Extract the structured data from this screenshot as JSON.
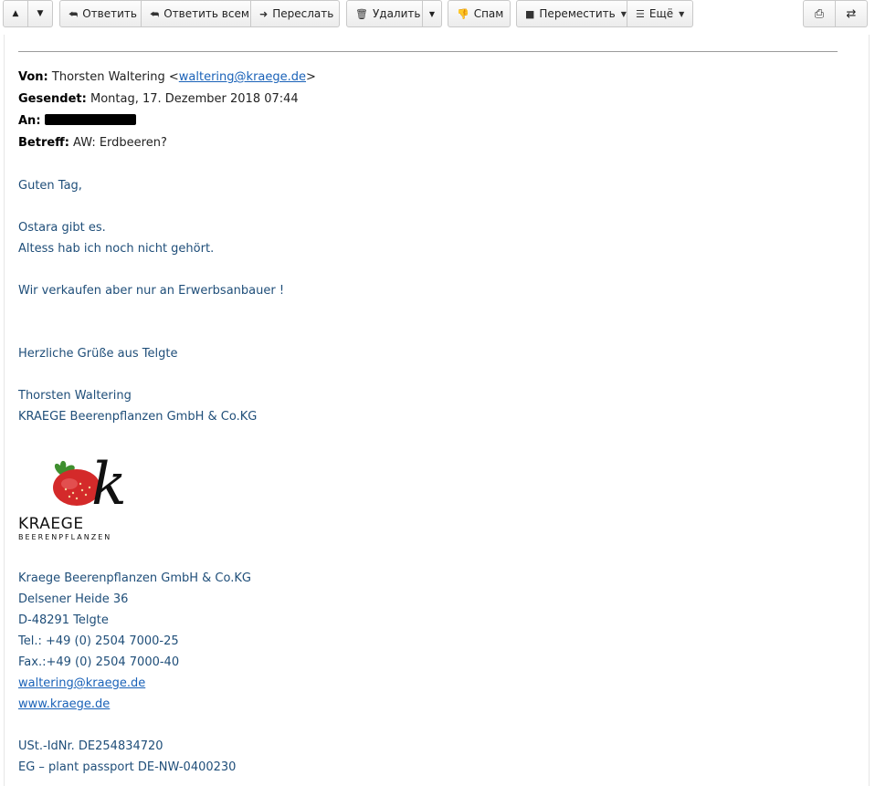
{
  "toolbar": {
    "prev_icon": "triangle-up-icon",
    "next_icon": "triangle-down-icon",
    "reply_label": "Ответить",
    "reply_all_label": "Ответить всем",
    "forward_label": "Переслать",
    "delete_label": "Удалить",
    "spam_label": "Спам",
    "move_label": "Переместить",
    "more_label": "Ещё"
  },
  "message": {
    "from_label": "Von:",
    "from_name": "Thorsten Waltering <",
    "from_email": "waltering@kraege.de",
    "from_close": ">",
    "sent_label": "Gesendet:",
    "sent_value": "Montag, 17. Dezember 2018 07:44",
    "to_label": "An:",
    "subject_label": "Betreff:",
    "subject_value": "AW: Erdbeeren?",
    "body": {
      "greeting": "Guten Tag,",
      "line1": "Ostara gibt es.",
      "line2": "Altess hab ich noch nicht gehört.",
      "line3": "Wir verkaufen aber nur an Erwerbsanbauer !",
      "closing": "Herzliche Grüße aus Telgte",
      "sig_name": "Thorsten Waltering",
      "sig_company": "KRAEGE  Beerenpflanzen GmbH & Co.KG"
    },
    "logo": {
      "name": "KRAEGE",
      "sub": "BEERENPFLANZEN",
      "letter": "k"
    },
    "footer": {
      "company": "Kraege Beerenpflanzen GmbH & Co.KG",
      "street": "Delsener Heide 36",
      "city": "D-48291 Telgte",
      "tel": "Tel.: +49 (0) 2504 7000-25",
      "fax": "Fax.:+49 (0) 2504 7000-40",
      "email": "waltering@kraege.de",
      "web": "www.kraege.de",
      "vat": "USt.-IdNr. DE254834720",
      "passport": "EG – plant passport DE-NW-0400230"
    }
  },
  "colors": {
    "body_text": "#1f4e79",
    "link": "#1a62b8",
    "strawberry": "#d42a2a"
  }
}
